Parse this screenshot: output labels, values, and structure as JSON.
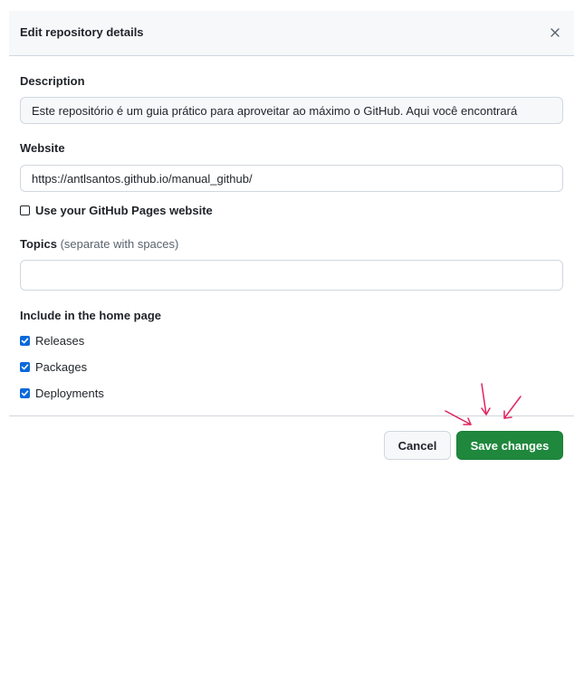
{
  "dialog": {
    "title": "Edit repository details",
    "close_icon": "close-icon"
  },
  "description": {
    "label": "Description",
    "value": "Este repositório é um guia prático para aproveitar ao máximo o GitHub. Aqui você encontrará"
  },
  "website": {
    "label": "Website",
    "value": "https://antlsantos.github.io/manual_github/",
    "pages_checkbox_label": "Use your GitHub Pages website",
    "pages_checked": false
  },
  "topics": {
    "label": "Topics",
    "hint": "(separate with spaces)",
    "value": ""
  },
  "home_page": {
    "label": "Include in the home page",
    "items": [
      {
        "label": "Releases",
        "checked": true
      },
      {
        "label": "Packages",
        "checked": true
      },
      {
        "label": "Deployments",
        "checked": true
      }
    ]
  },
  "footer": {
    "cancel_label": "Cancel",
    "save_label": "Save changes"
  },
  "colors": {
    "primary_button": "#1f883d",
    "checkbox_checked": "#0969da",
    "annotation_arrows": "#e0245e"
  }
}
